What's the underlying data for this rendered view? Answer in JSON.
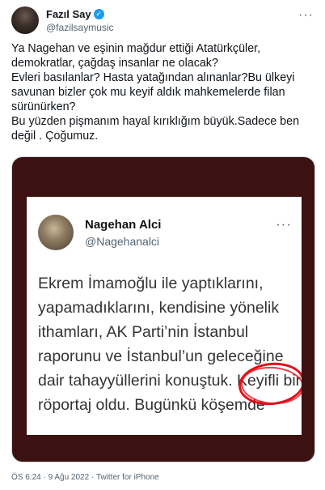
{
  "author": {
    "name": "Fazıl Say",
    "handle": "@fazilsaymusic",
    "verified_mark": "✓",
    "more_icon": "···"
  },
  "tweet": {
    "text": "Ya Nagehan ve eşinin mağdur ettiği Atatürkçüler, demokratlar, çağdaş insanlar ne olacak?\nEvleri basılanlar? Hasta yatağından alınanlar?Bu ülkeyi savunan bizler çok mu keyif aldık mahkemelerde filan sürünürken?\nBu yüzden pişmanım hayal kırıklığım büyük.Sadece ben değil . Çoğumuz."
  },
  "quoted": {
    "name": "Nagehan Alci",
    "handle": "@Nagehanalci",
    "more_icon": "···",
    "text": "Ekrem İmamoğlu ile yaptıklarını, yapamadıklarını, kendisine yönelik ithamları, AK Parti’nin İstanbul raporunu ve İstanbul’un geleceğine dair tahayyüllerini konuştuk. Keyifli bir röportaj oldu. Bugünkü köşemde"
  },
  "meta": {
    "timestamp": "ÖS 6:24 · 9 Ağu 2022 · Twitter for iPhone"
  },
  "colors": {
    "accent": "#1d9bf0",
    "media_background": "#3c1111",
    "highlight_circle": "#e0101a"
  }
}
